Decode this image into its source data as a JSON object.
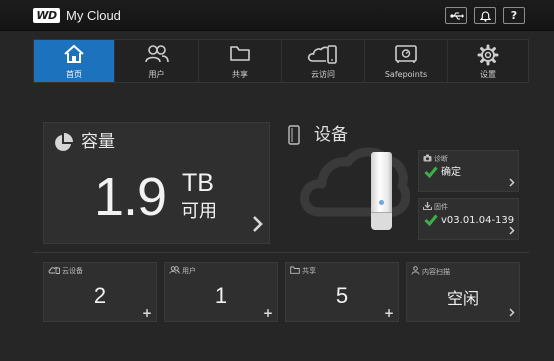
{
  "header": {
    "logo_text": "WD",
    "title": "My Cloud",
    "buttons": [
      {
        "name": "usb",
        "icon": "usb-icon"
      },
      {
        "name": "alerts",
        "icon": "bell-icon"
      },
      {
        "name": "help",
        "label": "?",
        "icon": "help-icon"
      }
    ]
  },
  "nav": {
    "active_color": "#1d72bd",
    "items": [
      {
        "label": "首页",
        "icon": "home-icon",
        "active": true
      },
      {
        "label": "用户",
        "icon": "users-icon"
      },
      {
        "label": "共享",
        "icon": "folder-icon"
      },
      {
        "label": "云访问",
        "icon": "cloud-access-icon"
      },
      {
        "label": "Safepoints",
        "icon": "safe-icon"
      },
      {
        "label": "设置",
        "icon": "gear-icon"
      }
    ]
  },
  "capacity": {
    "title": "容量",
    "value": "1.9",
    "unit": "TB",
    "status": "可用"
  },
  "device": {
    "title": "设备",
    "diagnostics": {
      "label": "诊断",
      "value": "确定",
      "status_color": "#3fae49"
    },
    "firmware": {
      "label": "固件",
      "value": "v03.01.04-139",
      "status_color": "#3fae49"
    }
  },
  "tiles": [
    {
      "label": "云设备",
      "icon": "cloud-device-icon",
      "value": "2",
      "action": "+"
    },
    {
      "label": "用户",
      "icon": "users-icon",
      "value": "1",
      "action": "+"
    },
    {
      "label": "共享",
      "icon": "folder-icon",
      "value": "5",
      "action": "+"
    },
    {
      "label": "内容扫描",
      "icon": "media-scan-icon",
      "value": "空闲",
      "action": "chevron"
    }
  ]
}
